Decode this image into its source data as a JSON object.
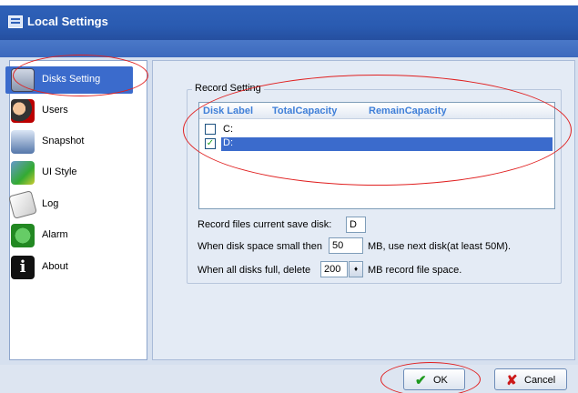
{
  "window": {
    "title": "Local Settings"
  },
  "sidebar": {
    "items": [
      {
        "label": "Disks Setting",
        "icon": "disk-icon",
        "selected": true
      },
      {
        "label": "Users",
        "icon": "users-icon",
        "selected": false
      },
      {
        "label": "Snapshot",
        "icon": "camera-icon",
        "selected": false
      },
      {
        "label": "UI Style",
        "icon": "monitor-icon",
        "selected": false
      },
      {
        "label": "Log",
        "icon": "log-icon",
        "selected": false
      },
      {
        "label": "Alarm",
        "icon": "alarm-icon",
        "selected": false
      },
      {
        "label": "About",
        "icon": "info-icon",
        "selected": false
      }
    ]
  },
  "record_setting": {
    "group_label": "Record Setting",
    "columns": [
      "Disk Label",
      "TotalCapacity",
      "RemainCapacity"
    ],
    "rows": [
      {
        "label": "C:",
        "checked": false,
        "selected": false
      },
      {
        "label": "D:",
        "checked": true,
        "selected": true
      }
    ],
    "current_disk_label": "Record files current save disk:",
    "current_disk_value": "D",
    "small_space_prefix": "When disk space small then",
    "small_space_value": "50",
    "small_space_suffix": "MB, use next disk(at least 50M).",
    "full_prefix": "When all disks full, delete",
    "full_value": "200",
    "full_suffix": "MB record file space."
  },
  "buttons": {
    "ok": "OK",
    "cancel": "Cancel"
  },
  "colors": {
    "title_bar": "#2f61b8",
    "selection": "#3b6bcc",
    "annotation": "#e02020",
    "header_text": "#3f7fd8"
  }
}
